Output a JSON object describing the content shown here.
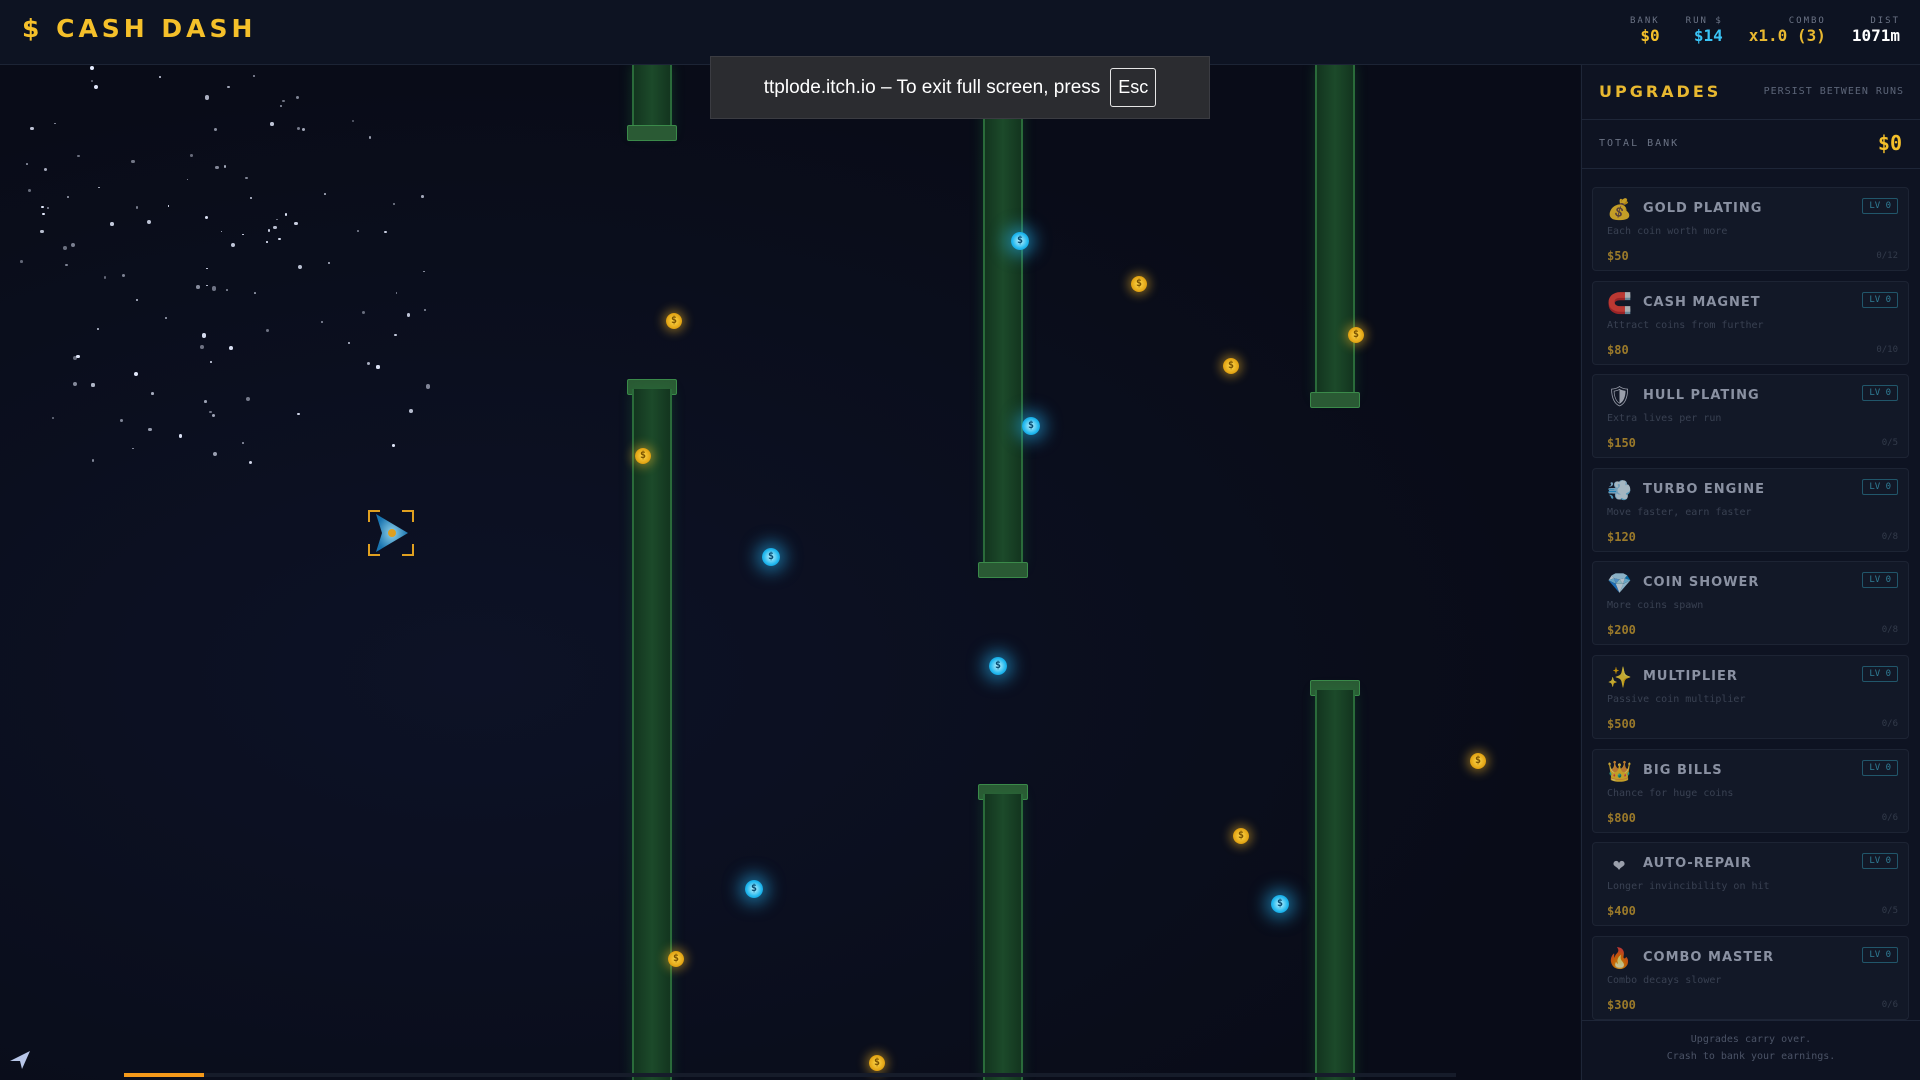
{
  "header": {
    "logo": "$ CASH DASH"
  },
  "stats": [
    {
      "label": "BANK",
      "value": "$0",
      "cls": "v-bank"
    },
    {
      "label": "RUN $",
      "value": "$14",
      "cls": "v-run"
    },
    {
      "label": "COMBO",
      "value": "x1.0 (3)",
      "cls": "v-combo"
    },
    {
      "label": "DIST",
      "value": "1071m",
      "cls": "v-dist"
    }
  ],
  "toast": {
    "text": "ttplode.itch.io – To exit full screen, press",
    "key": "Esc"
  },
  "coin_glyph": "$",
  "run_progress": 0.06,
  "panel": {
    "title": "UPGRADES",
    "subtitle": "PERSIST BETWEEN RUNS",
    "bank_label": "TOTAL BANK",
    "bank_value": "$0",
    "footer_line1": "Upgrades carry over.",
    "footer_line2": "Crash to bank your earnings."
  },
  "upgrades": [
    {
      "icon": "moneybag-icon",
      "glyph": "💰",
      "name": "GOLD PLATING",
      "desc": "Each coin worth more",
      "cost": "$50",
      "level": "LV 0",
      "max": "0/12"
    },
    {
      "icon": "magnet-icon",
      "glyph": "🧲",
      "name": "CASH MAGNET",
      "desc": "Attract coins from further",
      "cost": "$80",
      "level": "LV 0",
      "max": "0/10"
    },
    {
      "icon": "shield-icon",
      "glyph": "🛡",
      "name": "HULL PLATING",
      "desc": "Extra lives per run",
      "cost": "$150",
      "level": "LV 0",
      "max": "0/5"
    },
    {
      "icon": "wind-icon",
      "glyph": "💨",
      "name": "TURBO ENGINE",
      "desc": "Move faster, earn faster",
      "cost": "$120",
      "level": "LV 0",
      "max": "0/8"
    },
    {
      "icon": "gem-icon",
      "glyph": "💎",
      "name": "COIN SHOWER",
      "desc": "More coins spawn",
      "cost": "$200",
      "level": "LV 0",
      "max": "0/8"
    },
    {
      "icon": "sparkles-icon",
      "glyph": "✨",
      "name": "MULTIPLIER",
      "desc": "Passive coin multiplier",
      "cost": "$500",
      "level": "LV 0",
      "max": "0/6"
    },
    {
      "icon": "crown-icon",
      "glyph": "👑",
      "name": "BIG BILLS",
      "desc": "Chance for huge coins",
      "cost": "$800",
      "level": "LV 0",
      "max": "0/6"
    },
    {
      "icon": "heart-icon",
      "glyph": "❤",
      "name": "AUTO-REPAIR",
      "desc": "Longer invincibility on hit",
      "cost": "$400",
      "level": "LV 0",
      "max": "0/5"
    },
    {
      "icon": "fire-icon",
      "glyph": "🔥",
      "name": "COMBO MASTER",
      "desc": "Combo decays slower",
      "cost": "$300",
      "level": "LV 0",
      "max": "0/6"
    }
  ]
}
